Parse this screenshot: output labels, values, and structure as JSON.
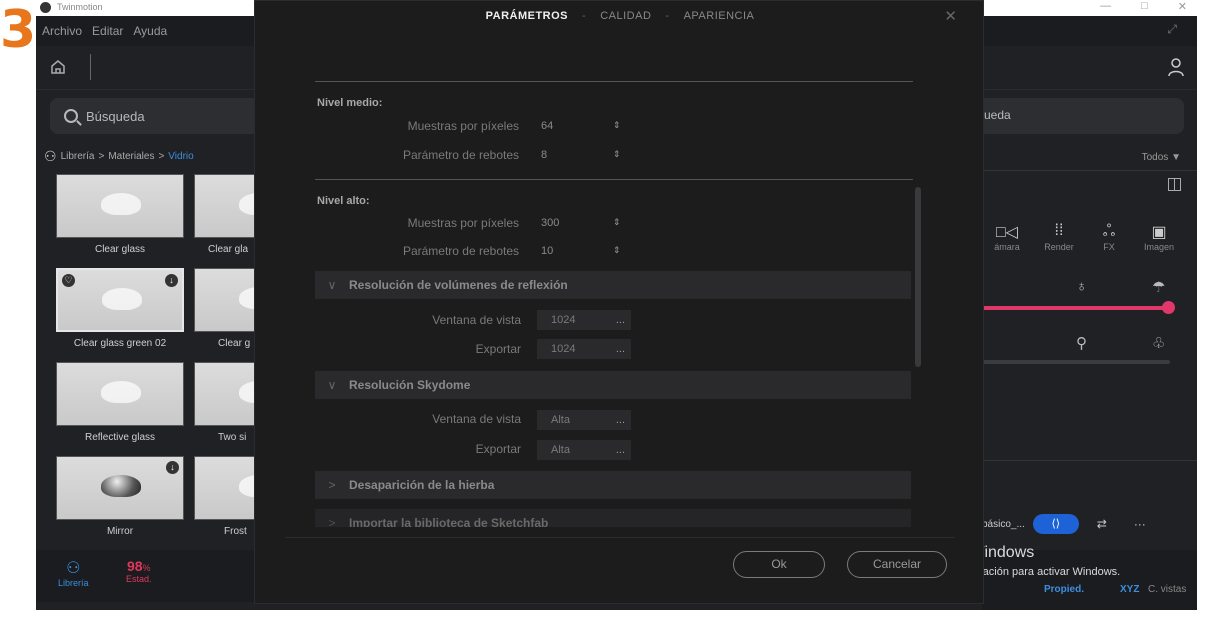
{
  "step_badge": "3",
  "window": {
    "title": "Twinmotion",
    "controls": [
      "—",
      "□",
      "✕"
    ]
  },
  "menu": [
    "Archivo",
    "Editar",
    "Ayuda"
  ],
  "icons": {
    "home": "home-icon",
    "user": "user-add-icon",
    "search": "search-icon",
    "library": "library-icon",
    "split": "split-view-icon",
    "close": "close-icon"
  },
  "left_panel": {
    "search_placeholder": "Búsqueda",
    "breadcrumb": [
      "Librería",
      "Materiales",
      "Vidrio"
    ],
    "thumbnails": [
      {
        "label": "Clear glass",
        "style": "glass"
      },
      {
        "label": "Clear gla",
        "style": "glass"
      },
      {
        "label": "Clear glass green 02",
        "style": "glass",
        "selected": true
      },
      {
        "label": "Clear g",
        "style": "glass"
      },
      {
        "label": "Reflective glass",
        "style": "glass"
      },
      {
        "label": "Two si",
        "style": "glass"
      },
      {
        "label": "Mirror",
        "style": "mirror"
      },
      {
        "label": "Frost",
        "style": "glass"
      }
    ],
    "bottom": {
      "library_label": "Librería",
      "stat_value": "98",
      "stat_unit": "%",
      "stat_label": "Estad."
    }
  },
  "right_panel": {
    "search_partial": "ueda",
    "filter": "Todos ▼",
    "tools": [
      {
        "label": "ámara",
        "icon": "camera-icon"
      },
      {
        "label": "Render",
        "icon": "render-icon"
      },
      {
        "label": "FX",
        "icon": "fx-icon"
      },
      {
        "label": "Imagen",
        "icon": "image-icon"
      }
    ],
    "chip_text": "básico_...",
    "bottom_tabs": [
      "Propied.",
      "XYZ",
      "C. vistas"
    ]
  },
  "modal": {
    "tabs": [
      "PARÁMETROS",
      "CALIDAD",
      "APARIENCIA"
    ],
    "active_tab": "PARÁMETROS",
    "tab_separator": "-",
    "levels": [
      {
        "title": "Nivel medio:",
        "rows": [
          {
            "label": "Muestras por píxeles",
            "value": "64"
          },
          {
            "label": "Parámetro de rebotes",
            "value": "8"
          }
        ]
      },
      {
        "title": "Nivel alto:",
        "rows": [
          {
            "label": "Muestras por píxeles",
            "value": "300"
          },
          {
            "label": "Parámetro de rebotes",
            "value": "10"
          }
        ]
      }
    ],
    "sections": [
      {
        "title": "Resolución de volúmenes de reflexión",
        "expanded": true,
        "rows": [
          {
            "label": "Ventana de vista",
            "value": "1024"
          },
          {
            "label": "Exportar",
            "value": "1024"
          }
        ]
      },
      {
        "title": "Resolución Skydome",
        "expanded": true,
        "rows": [
          {
            "label": "Ventana de vista",
            "value": "Alta"
          },
          {
            "label": "Exportar",
            "value": "Alta"
          }
        ]
      },
      {
        "title": "Desaparición de la hierba",
        "expanded": false
      },
      {
        "title": "Importar la biblioteca de Sketchfab",
        "expanded": false
      }
    ],
    "buttons": {
      "ok": "Ok",
      "cancel": "Cancelar"
    }
  },
  "watermark": {
    "title": "Activar Windows",
    "subtitle": "Ve a Configuración para activar Windows."
  },
  "colors": {
    "accent_pink": "#e0386b",
    "accent_blue": "#1d62d6",
    "link_blue": "#3b8fe0",
    "step_orange": "#e8761c"
  }
}
